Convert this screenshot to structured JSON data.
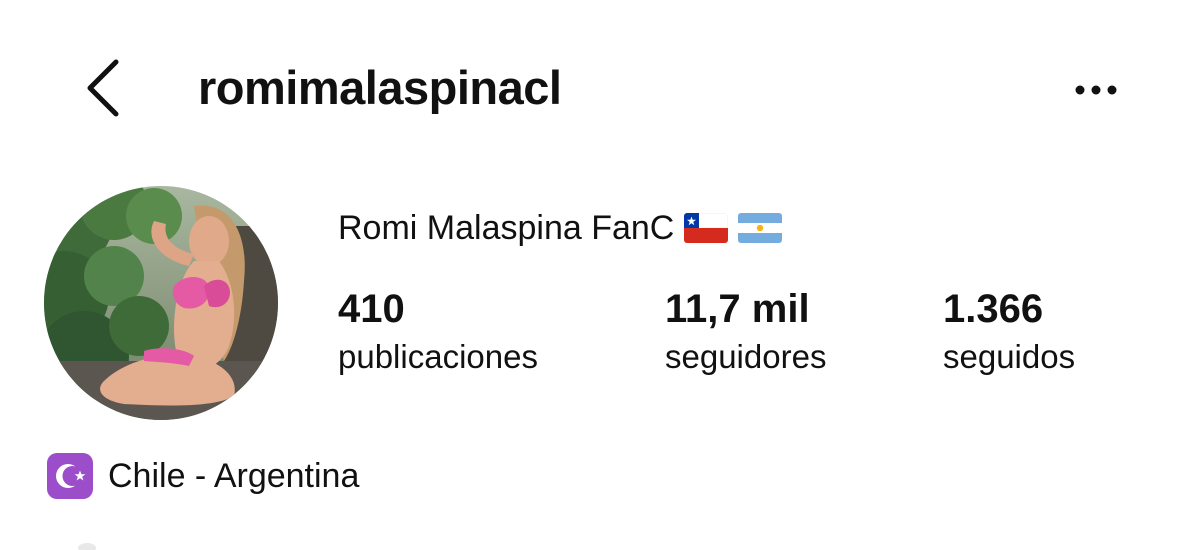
{
  "header": {
    "username": "romimalaspinacl",
    "back_icon": "chevron-left-icon",
    "more_icon": "more-horizontal-icon"
  },
  "profile": {
    "display_name": "Romi Malaspina FanC",
    "flags": [
      "chile-flag-icon",
      "argentina-flag-icon"
    ],
    "avatar": "profile-photo"
  },
  "stats": [
    {
      "value": "410",
      "label": "publicaciones"
    },
    {
      "value": "11,7 mil",
      "label": "seguidores"
    },
    {
      "value": "1.366",
      "label": "seguidos"
    }
  ],
  "bio": {
    "icon": "star-and-crescent-icon",
    "text": "Chile - Argentina"
  },
  "colors": {
    "text": "#111111",
    "background": "#ffffff",
    "bio_icon_bg": "#9b4dca"
  }
}
